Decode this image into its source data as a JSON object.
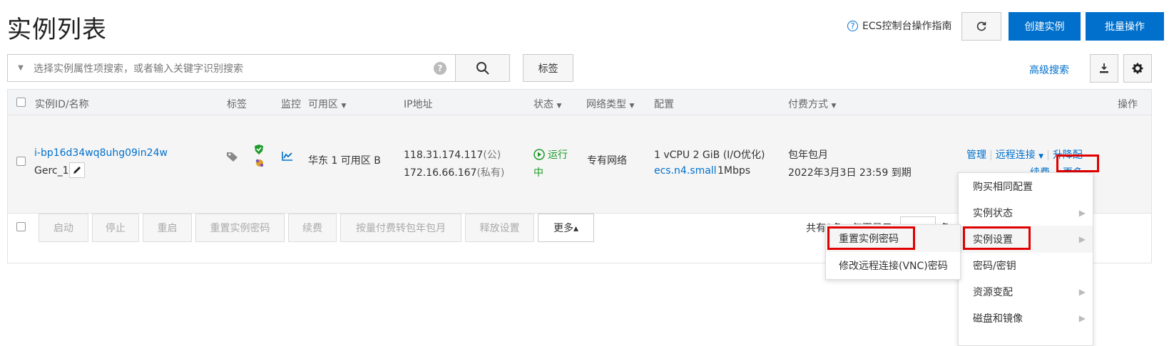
{
  "page": {
    "title": "实例列表",
    "guide_label": "ECS控制台操作指南",
    "create_label": "创建实例",
    "batch_label": "批量操作",
    "search_placeholder": "选择实例属性项搜索，或者输入关键字识别搜索",
    "tag_button": "标签",
    "advanced_search": "高级搜索"
  },
  "table": {
    "headers": {
      "instance": "实例ID/名称",
      "tags": "标签",
      "monitor": "监控",
      "zone": "可用区",
      "ip": "IP地址",
      "status": "状态",
      "network": "网络类型",
      "config": "配置",
      "billing": "付费方式",
      "actions": "操作"
    },
    "row": {
      "instance_id": "i-bp16d34wq8uhg09in24w",
      "instance_name": "Gerc_1",
      "zone": "华东 1 可用区 B",
      "ip_public": "118.31.174.117(公)",
      "ip_private": "172.16.66.167(私有)",
      "status_line1": "运行",
      "status_line2": "中",
      "network": "专有网络",
      "config_line1": "1 vCPU 2 GiB (I/O优化)",
      "config_type": "ecs.n4.small",
      "config_bandwidth": "1Mbps",
      "billing_type": "包年包月",
      "billing_expire": "2022年3月3日 23:59 到期",
      "action_manage": "管理",
      "action_remote": "远程连接",
      "action_upgrade": "升降配",
      "action_renew": "续费",
      "action_more": "更多"
    }
  },
  "footer": {
    "buttons": [
      "启动",
      "停止",
      "重启",
      "重置实例密码",
      "续费",
      "按量付费转包年包月",
      "释放设置"
    ],
    "more_label": "更多▴",
    "pager_text": "共有1条，每页显示",
    "pager_unit": "条"
  },
  "menu_main": {
    "items": [
      {
        "label": "购买相同配置",
        "submenu": false
      },
      {
        "label": "实例状态",
        "submenu": true
      },
      {
        "label": "实例设置",
        "submenu": true
      },
      {
        "label": "密码/密钥",
        "submenu": false
      },
      {
        "label": "资源变配",
        "submenu": true
      },
      {
        "label": "磁盘和镜像",
        "submenu": true
      }
    ]
  },
  "menu_sub": {
    "items": [
      "重置实例密码",
      "修改远程连接(VNC)密码"
    ]
  },
  "colors": {
    "primary": "#0070cc",
    "status_green": "#1b9a28",
    "highlight_red": "#e00000"
  }
}
